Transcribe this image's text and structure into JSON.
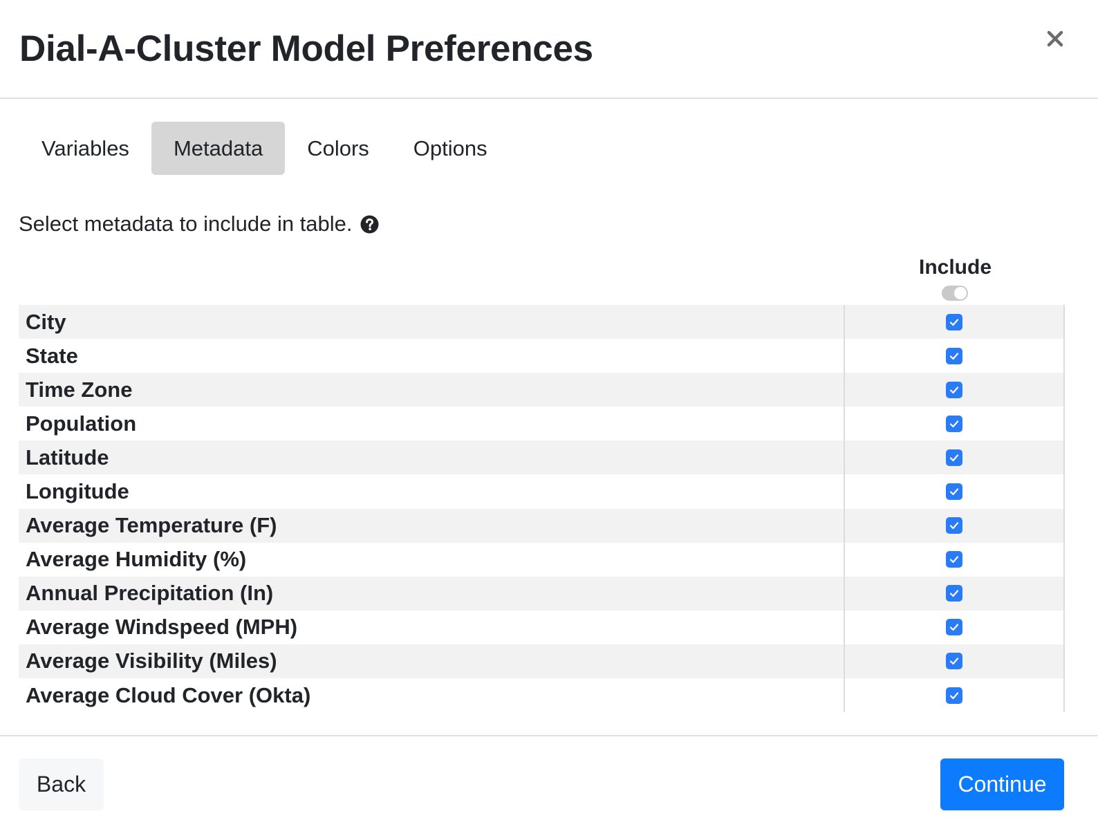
{
  "dialog": {
    "title": "Dial-A-Cluster Model Preferences",
    "close_icon": "close-icon"
  },
  "tabs": [
    {
      "label": "Variables",
      "active": false
    },
    {
      "label": "Metadata",
      "active": true
    },
    {
      "label": "Colors",
      "active": false
    },
    {
      "label": "Options",
      "active": false
    }
  ],
  "instructions": {
    "text": "Select metadata to include in table.",
    "icon": "help-icon"
  },
  "table": {
    "include_header": "Include",
    "master_toggle_on": false,
    "rows": [
      {
        "label": "City",
        "included": true
      },
      {
        "label": "State",
        "included": true
      },
      {
        "label": "Time Zone",
        "included": true
      },
      {
        "label": "Population",
        "included": true
      },
      {
        "label": "Latitude",
        "included": true
      },
      {
        "label": "Longitude",
        "included": true
      },
      {
        "label": "Average Temperature (F)",
        "included": true
      },
      {
        "label": "Average Humidity (%)",
        "included": true
      },
      {
        "label": "Annual Precipitation (In)",
        "included": true
      },
      {
        "label": "Average Windspeed (MPH)",
        "included": true
      },
      {
        "label": "Average Visibility (Miles)",
        "included": true
      },
      {
        "label": "Average Cloud Cover (Okta)",
        "included": true
      }
    ]
  },
  "footer": {
    "back_label": "Back",
    "continue_label": "Continue"
  },
  "colors": {
    "primary": "#0d7bfd",
    "checkbox": "#2a7cf6",
    "active_tab": "#d6d6d6",
    "striped_row": "#f2f2f2"
  }
}
